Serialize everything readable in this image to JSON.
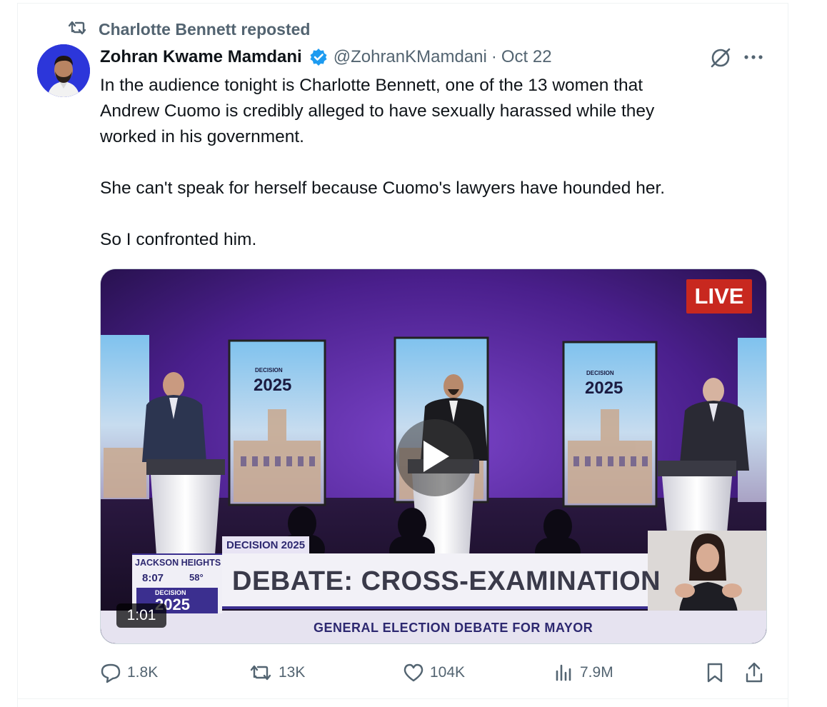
{
  "repost": {
    "label": "Charlotte Bennett reposted"
  },
  "tweet": {
    "author_name": "Zohran Kwame Mamdani",
    "handle": "@ZohranKMamdani",
    "separator": "·",
    "date": "Oct 22",
    "text_lines": [
      "In the audience tonight is Charlotte Bennett, one of the 13 women that",
      "Andrew Cuomo is credibly alleged to have sexually harassed while they",
      "worked in his government.",
      "She can't speak for herself because Cuomo's lawyers have hounded her.",
      "So I confronted him."
    ]
  },
  "video": {
    "live_badge": "LIVE",
    "screen_label_small": "DECISION",
    "screen_label_year": "2025",
    "tag": "DECISION 2025",
    "headline": "DEBATE: CROSS-EXAMINATION",
    "subline": "GENERAL ELECTION DEBATE FOR MAYOR",
    "location": "JACKSON HEIGHTS",
    "time": "8:07",
    "temperature": "58°",
    "brand_small": "DECISION",
    "brand_year": "2025",
    "duration": "1:01"
  },
  "actions": {
    "replies": "1.8K",
    "reposts": "13K",
    "likes": "104K",
    "views": "7.9M"
  },
  "colors": {
    "verified": "#1d9bf0",
    "secondary_text": "#536471",
    "live_red": "#c8281f",
    "stage_purple": "#5a2ca0"
  },
  "icons": [
    "repost-icon",
    "verified-icon",
    "grok-icon",
    "more-icon",
    "play-icon",
    "reply-icon",
    "like-icon",
    "views-icon",
    "bookmark-icon",
    "share-icon"
  ]
}
